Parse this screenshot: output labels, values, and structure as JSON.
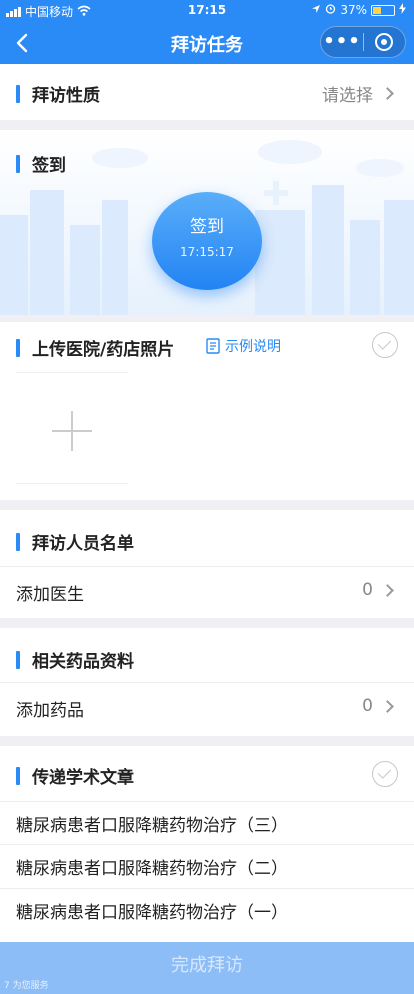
{
  "status": {
    "carrier": "中国移动",
    "time": "17:15",
    "battery": "37%"
  },
  "nav": {
    "title": "拜访任务",
    "more": "•••"
  },
  "visit_nature": {
    "label": "拜访性质",
    "value": "请选择"
  },
  "signin": {
    "section": "签到",
    "button": "签到",
    "time": "17:15:17"
  },
  "upload": {
    "label": "上传医院/药店照片",
    "example": "示例说明"
  },
  "visitors": {
    "section": "拜访人员名单",
    "add": "添加医生",
    "count": "0"
  },
  "drugs": {
    "section": "相关药品资料",
    "add": "添加药品",
    "count": "0"
  },
  "articles": {
    "section": "传递学术文章",
    "items": [
      "糖尿病患者口服降糖药物治疗（三）",
      "糖尿病患者口服降糖药物治疗（二）",
      "糖尿病患者口服降糖药物治疗（一）"
    ]
  },
  "footer": {
    "submit": "完成拜访",
    "watermark": "7 为您服务"
  },
  "colors": {
    "brand": "#2a8af6",
    "footer_disabled": "#8dbdf6"
  }
}
